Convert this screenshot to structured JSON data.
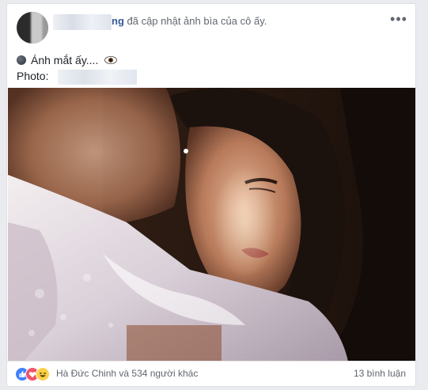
{
  "post": {
    "header_name_end": "ng",
    "header_action": " đã cập nhật ảnh bìa của cô ấy.",
    "caption": "Ánh mắt ấy....",
    "photo_label": "Photo:"
  },
  "footer": {
    "reactions_text": "Hà Đức Chinh và 534 người khác",
    "comments_text": "13 bình luận"
  },
  "icons": {
    "more": "more-options-icon",
    "caption_dot": "dark-circle-emoji",
    "eye": "eye-emoji",
    "reactions": [
      "like-reaction-icon",
      "love-reaction-icon",
      "haha-reaction-icon"
    ]
  },
  "colors": {
    "link": "#385898",
    "text_secondary": "#606770",
    "like": "#4080ff",
    "love": "#f25268",
    "haha": "#fcd14a"
  }
}
